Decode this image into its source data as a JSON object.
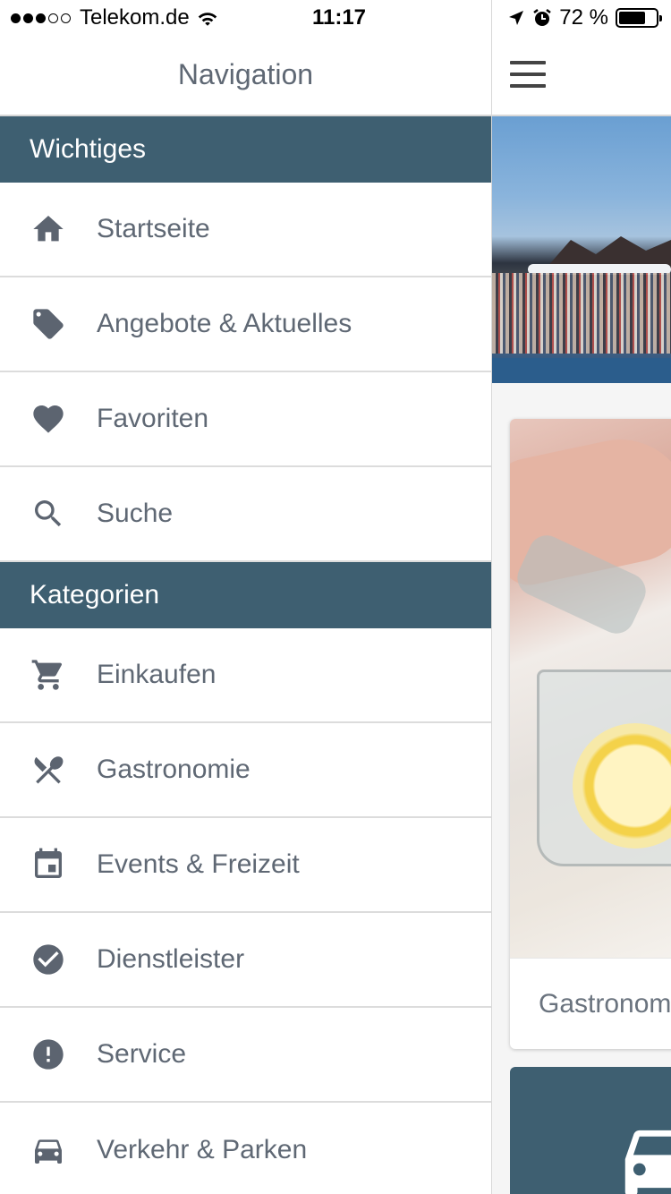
{
  "status_bar": {
    "carrier": "Telekom.de",
    "signal_dots_filled": 3,
    "signal_dots_total": 5,
    "time": "11:17",
    "battery_percent": "72 %",
    "battery_level": 0.72
  },
  "drawer": {
    "title": "Navigation",
    "sections": [
      {
        "header": "Wichtiges",
        "items": [
          {
            "label": "Startseite",
            "icon": "home-icon"
          },
          {
            "label": "Angebote & Aktuelles",
            "icon": "tag-icon"
          },
          {
            "label": "Favoriten",
            "icon": "heart-icon"
          },
          {
            "label": "Suche",
            "icon": "search-icon"
          }
        ]
      },
      {
        "header": "Kategorien",
        "items": [
          {
            "label": "Einkaufen",
            "icon": "cart-icon"
          },
          {
            "label": "Gastronomie",
            "icon": "cutlery-icon"
          },
          {
            "label": "Events & Freizeit",
            "icon": "calendar-icon"
          },
          {
            "label": "Dienstleister",
            "icon": "check-circle-icon"
          },
          {
            "label": "Service",
            "icon": "exclamation-circle-icon"
          },
          {
            "label": "Verkehr & Parken",
            "icon": "car-icon"
          }
        ]
      }
    ]
  },
  "main": {
    "category_card_label": "Gastronomie",
    "colors": {
      "section_header_bg": "#3e5f71",
      "icon_color": "#5c6470",
      "label_color": "#5f6874"
    }
  }
}
